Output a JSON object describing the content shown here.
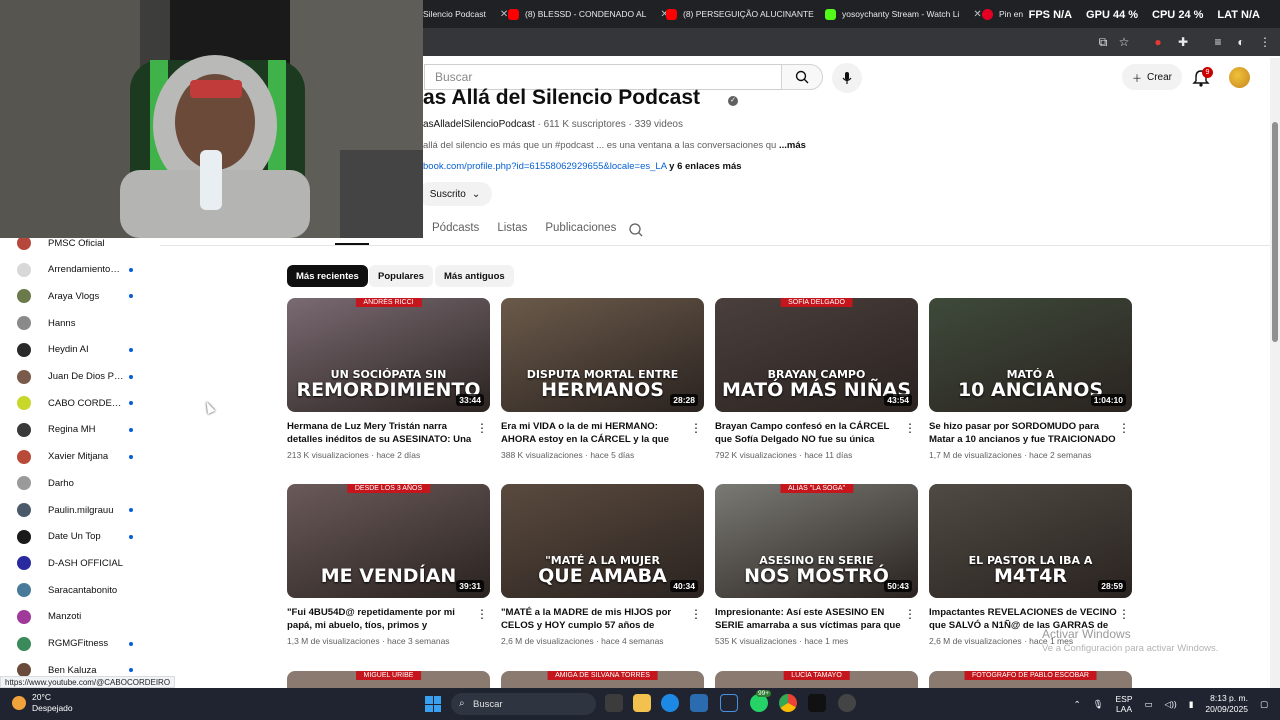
{
  "browser": {
    "tabs": [
      {
        "label": "Silencio Podcast",
        "color": "#ff0000"
      },
      {
        "label": "(8) BLESSD - CONDENADO AL",
        "color": "#ff0000"
      },
      {
        "label": "(8) PERSEGUIÇÃO ALUCINANTE",
        "color": "#ff0000"
      },
      {
        "label": "yosoychanty Stream - Watch Li",
        "color": "#53fc18"
      },
      {
        "label": "Pin en ",
        "color": "#e60023"
      }
    ],
    "stats": [
      {
        "label": "FPS",
        "value": "N/A"
      },
      {
        "label": "GPU",
        "value": "44 %"
      },
      {
        "label": "CPU",
        "value": "24 %"
      },
      {
        "label": "LAT",
        "value": "N/A"
      }
    ]
  },
  "header": {
    "search_placeholder": "Buscar",
    "create_label": "Crear",
    "notif_count": "9"
  },
  "channel": {
    "title": "as Allá del Silencio Podcast",
    "handle": "asAlladelSilencioPodcast",
    "subs": "611 K suscriptores",
    "videos": "339 videos",
    "description": "allá del silencio es más que un #podcast ... es una ventana a las conversaciones qu",
    "more": "...más",
    "link": "book.com/profile.php?id=61558062929655&locale=es_LA",
    "link_extra": "y 6 enlaces más",
    "subscribed_label": "Suscrito",
    "tabs": [
      "Pódcasts",
      "Listas",
      "Publicaciones"
    ]
  },
  "filters": [
    "Más recientes",
    "Populares",
    "Más antiguos"
  ],
  "sidebar": [
    {
      "name": "PMSC Oficial",
      "dot": false,
      "color": "#b5483b"
    },
    {
      "name": "Arrendamientos ...",
      "dot": true,
      "color": "#d8d8d8"
    },
    {
      "name": "Araya Vlogs",
      "dot": true,
      "color": "#6a7a4a"
    },
    {
      "name": "Hanns",
      "dot": false,
      "color": "#8a8a8a"
    },
    {
      "name": "Heydin AI",
      "dot": true,
      "color": "#2a2a2a"
    },
    {
      "name": "Juan De Dios Pa...",
      "dot": true,
      "color": "#7a5a4a"
    },
    {
      "name": "CABO CORDEIRO",
      "dot": true,
      "color": "#c8d82a"
    },
    {
      "name": "Regina MH",
      "dot": true,
      "color": "#3a3a3a"
    },
    {
      "name": "Xavier Mitjana",
      "dot": true,
      "color": "#b84a3a"
    },
    {
      "name": "Darho",
      "dot": false,
      "color": "#9a9a9a"
    },
    {
      "name": "Paulin.milgrauu",
      "dot": true,
      "color": "#4a5a6a"
    },
    {
      "name": "Date Un Top",
      "dot": true,
      "color": "#1a1a1a"
    },
    {
      "name": "D-ASH OFFICIAL",
      "dot": false,
      "color": "#2a2aa0"
    },
    {
      "name": "Saracantabonito",
      "dot": false,
      "color": "#4a7a9a"
    },
    {
      "name": "Manzoti",
      "dot": false,
      "color": "#a03a9a"
    },
    {
      "name": "RGMGFitness",
      "dot": true,
      "color": "#3a8a5a"
    },
    {
      "name": "Ben Kaluza",
      "dot": true,
      "color": "#6a4a3a"
    }
  ],
  "videos": [
    {
      "title": "Hermana de Luz Mery Tristán narra detalles inéditos de su ASESINATO: Una tragedia qu...",
      "views": "213 K visualizaciones",
      "age": "hace 2 días",
      "duration": "33:44",
      "line1": "UN SOCIÓPATA SIN",
      "line2": "REMORDIMIENTO",
      "tag": "ANDRÉS RICCI",
      "bg": "#7a6a72"
    },
    {
      "title": "Era mi VIDA o la de mi HERMANO: AHORA estoy en la CÁRCEL y la que sufre es mi...",
      "views": "388 K visualizaciones",
      "age": "hace 5 días",
      "duration": "28:28",
      "line1": "DISPUTA MORTAL ENTRE",
      "line2": "HERMANOS",
      "tag": "",
      "bg": "#6b5a4a"
    },
    {
      "title": "Brayan Campo confesó en la CÁRCEL que Sofía Delgado NO fue su única VÍCTIMAS:...",
      "views": "792 K visualizaciones",
      "age": "hace 11 días",
      "duration": "43:54",
      "line1": "BRAYAN CAMPO",
      "line2": "MATÓ MÁS NIÑAS",
      "tag": "SOFÍA DELGADO",
      "bg": "#4a3f3c"
    },
    {
      "title": "Se hizo pasar por SORDOMUDO para Matar a 10 ancianos y fue TRAICIONADO por sus...",
      "views": "1,7 M de visualizaciones",
      "age": "hace 2 semanas",
      "duration": "1:04:10",
      "line1": "MATÓ A",
      "line2": "10 ANCIANOS",
      "tag": "",
      "bg": "#3e4a3a"
    },
    {
      "title": "\"Fui 4BU54D@ repetidamente por mi papá, mi abuelo, tíos, primos y conocidos desde...",
      "views": "1,3 M de visualizaciones",
      "age": "hace 3 semanas",
      "duration": "39:31",
      "line1": "",
      "line2": "ME VENDÍAN",
      "tag": "DESDE LOS 3 AÑOS",
      "bg": "#6a5a5a"
    },
    {
      "title": "\"MATÉ a la MADRE de mis HIJOS por CELOS y HOY cumplo 57 años de CÁRCEL\" Preso...",
      "views": "2,6 M de visualizaciones",
      "age": "hace 4 semanas",
      "duration": "40:34",
      "line1": "\"MATÉ A LA MUJER",
      "line2": "QUE AMABA",
      "tag": "",
      "bg": "#5a4a3e"
    },
    {
      "title": "Impresionante: Así este ASESINO EN SERIE amarraba a sus víctimas para que ellas...",
      "views": "535 K visualizaciones",
      "age": "hace 1 mes",
      "duration": "50:43",
      "line1": "ASESINO EN SERIE",
      "line2": "NOS MOSTRÓ",
      "tag": "ALIAS \"LA SOGA\"",
      "bg": "#7a7a74"
    },
    {
      "title": "Impactantes REVELACIONES de VECINO que SALVÓ a N1Ñ@ de las GARRAS de PASTOR...",
      "views": "2,6 M de visualizaciones",
      "age": "hace 1 mes",
      "duration": "28:59",
      "line1": "EL PASTOR LA IBA A",
      "line2": "M4T4R",
      "tag": "",
      "bg": "#4f4a44"
    }
  ],
  "bottom_tags": [
    "MIGUEL URIBE",
    "AMIGA DE SILVANA TORRES",
    "LUCÍA TAMAYO",
    "FOTÓGRAFO DE PABLO ESCOBAR"
  ],
  "status_url": "https://www.youtube.com/@CABOCORDEIRO",
  "watermark": {
    "line1": "Activar Windows",
    "line2": "Ve a Configuración para activar Windows."
  },
  "taskbar": {
    "temp": "20°C",
    "weather": "Despejado",
    "search": "Buscar",
    "lang1": "ESP",
    "lang2": "LAA",
    "time": "8:13 p. m.",
    "date": "20/09/2025",
    "badge": "99+"
  }
}
